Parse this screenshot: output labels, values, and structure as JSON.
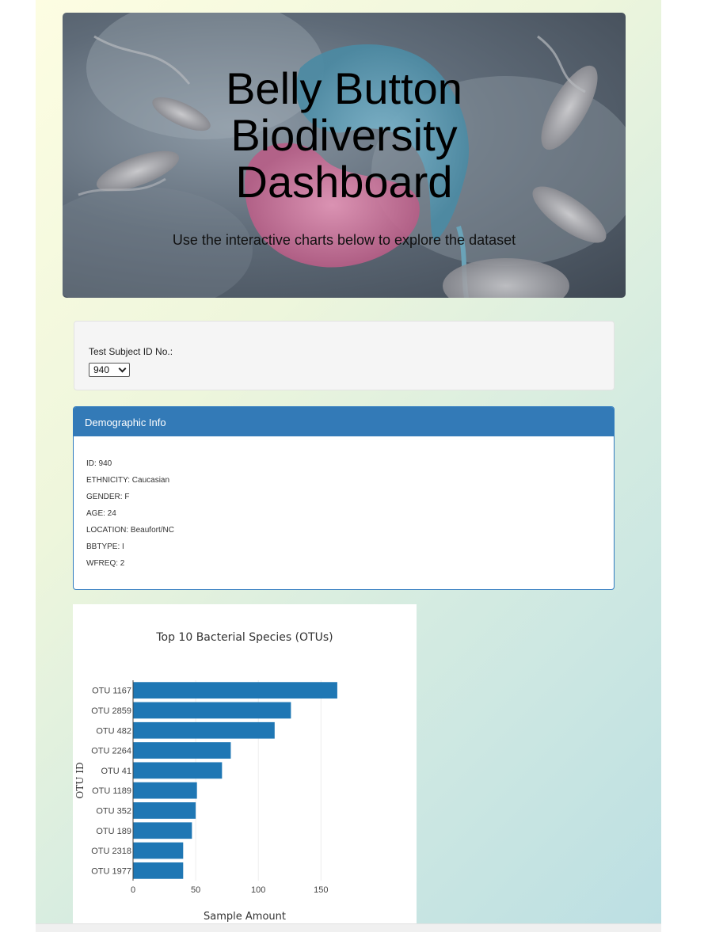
{
  "hero": {
    "title_lines": [
      "Belly Button",
      "Biodiversity",
      "Dashboard"
    ],
    "lead": "Use the interactive charts below to explore the dataset"
  },
  "selector": {
    "label": "Test Subject ID No.:",
    "selected": "940"
  },
  "demographics": {
    "heading": "Demographic Info",
    "lines": [
      "ID: 940",
      "ETHNICITY: Caucasian",
      "GENDER: F",
      "AGE: 24",
      "LOCATION: Beaufort/NC",
      "BBTYPE: I",
      "WFREQ: 2"
    ]
  },
  "colors": {
    "panel_header": "#337ab7",
    "bar": "#1f77b4"
  },
  "chart_data": {
    "type": "bar",
    "orientation": "horizontal",
    "title": "Top 10 Bacterial Species (OTUs)",
    "xlabel": "Sample Amount",
    "ylabel": "OTU ID",
    "categories": [
      "OTU 1167",
      "OTU 2859",
      "OTU 482",
      "OTU 2264",
      "OTU 41",
      "OTU 1189",
      "OTU 352",
      "OTU 189",
      "OTU 2318",
      "OTU 1977"
    ],
    "values": [
      163,
      126,
      113,
      78,
      71,
      51,
      50,
      47,
      40,
      40
    ],
    "xlim": [
      0,
      170
    ],
    "xticks": [
      0,
      50,
      100,
      150
    ],
    "grid": true
  }
}
